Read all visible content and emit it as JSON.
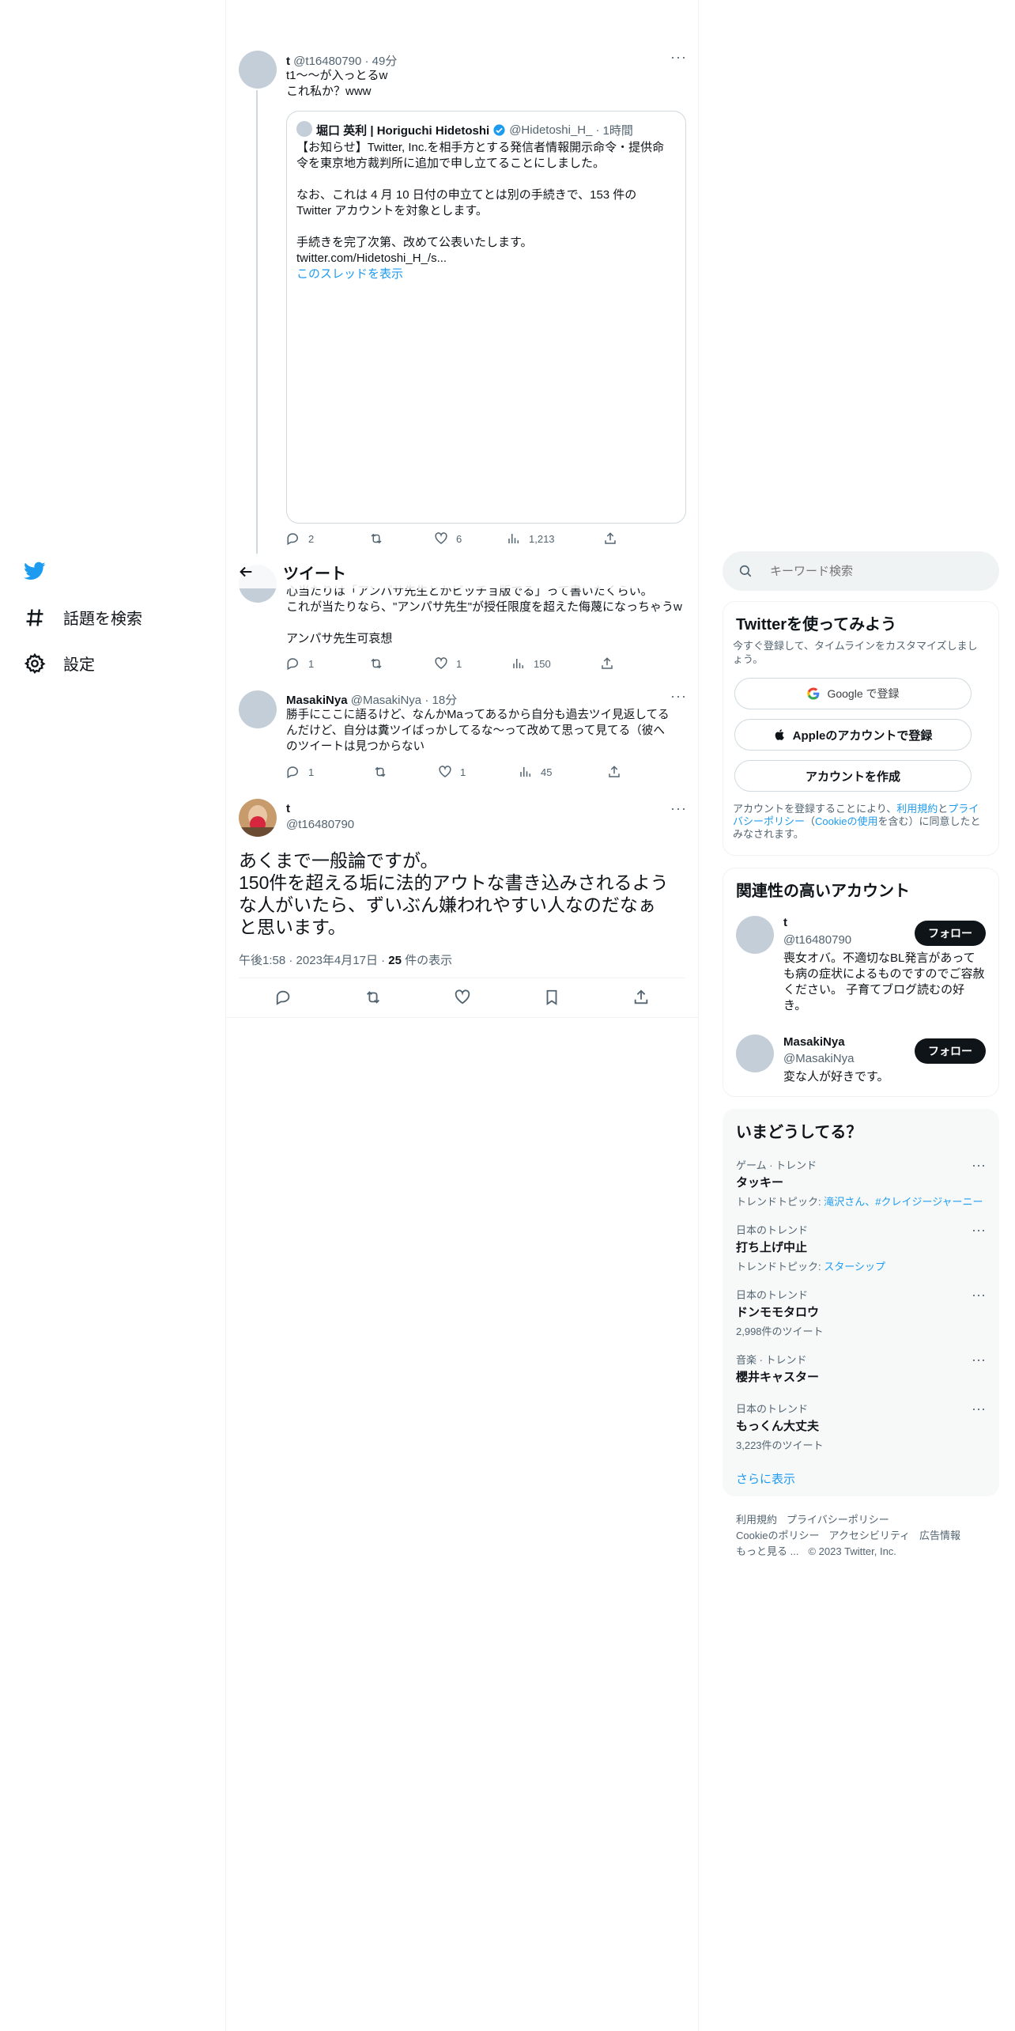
{
  "colors": {
    "accent": "#1d9bf0",
    "text": "#0f1419",
    "muted": "#536471",
    "border": "#eff3f4"
  },
  "nav": {
    "items": [
      {
        "label": "話題を検索",
        "icon": "hashtag-icon"
      },
      {
        "label": "設定",
        "icon": "gear-icon"
      }
    ]
  },
  "header": {
    "title": "ツイート"
  },
  "reply1": {
    "name": "t",
    "handle": "@t16480790",
    "time": "49分",
    "lines": [
      "t1〜〜が入っとるw",
      "これ私か？www"
    ],
    "quote": {
      "name": "堀口 英利 | Horiguchi Hidetoshi",
      "handle": "@Hidetoshi_H_",
      "time": "1時間",
      "lines": [
        "【お知らせ】Twitter, Inc.を相手方とする発信者情報開示命令・提供命",
        "令を東京地方裁判所に追加で申し立てることにしました。",
        "",
        "なお、これは 4 月 10 日付の申立てとは別の手続きで、153 件の",
        "Twitter アカウントを対象とします。",
        "",
        "手続きを完了次第、改めて公表いたします。",
        "twitter.com/Hidetoshi_H_/s..."
      ],
      "thread_link": "このスレッドを表示"
    },
    "stats": {
      "replies": "2",
      "retweets": "",
      "likes": "6",
      "views": "1,213"
    }
  },
  "reply2": {
    "lines": [
      "心当たりは「アンパサ先生とかピッチョ版でる」って書いたくらい。",
      "これが当たりなら、\"アンパサ先生\"が授任限度を超えた侮蔑になっちゃうw",
      "",
      "アンパサ先生可哀想"
    ],
    "stats": {
      "replies": "1",
      "retweets": "",
      "likes": "1",
      "views": "150"
    }
  },
  "reply3": {
    "name": "MasakiNya",
    "handle": "@MasakiNya",
    "time": "18分",
    "lines": [
      "勝手にここに語るけど、なんかMaってあるから自分も過去ツイ見返してる",
      "んだけど、自分は糞ツイばっかしてるな～って改めて思って見てる（彼へ",
      "のツイートは見つからない"
    ],
    "stats": {
      "replies": "1",
      "retweets": "",
      "likes": "1",
      "views": "45"
    }
  },
  "main_tweet": {
    "name": "t",
    "handle": "@t16480790",
    "lines": [
      "あくまで一般論ですが。",
      "150件を超える垢に法的アウトな書き込みされるよう",
      "な人がいたら、ずいぶん嫌われやすい人なのだなぁ",
      "と思います。"
    ],
    "time": "午後1:58",
    "date": "2023年4月17日",
    "views_count": "25",
    "views_label": "件の表示"
  },
  "search": {
    "placeholder": "キーワード検索"
  },
  "signup": {
    "title": "Twitterを使ってみよう",
    "desc_lines": [
      "今すぐ登録して、タイムラインをカスタマイズしまし",
      "ょう。"
    ],
    "google": "Google で登録",
    "apple": "Appleのアカウントで登録",
    "create": "アカウントを作成",
    "terms": {
      "p1": "アカウントを登録することにより、",
      "tos": "利用規約",
      "and": "と",
      "privacy1": "プライ",
      "privacy2": "バシーポリシー",
      "cookie_open": "（",
      "cookie": "Cookieの使用",
      "p2": "を含む）に同意したと",
      "p3": "みなされます。"
    }
  },
  "relevant": {
    "title": "関連性の高いアカウント",
    "follow_label": "フォロー",
    "accounts": [
      {
        "name": "t",
        "handle": "@t16480790",
        "bio_lines": [
          "喪女オバ。不適切なBL発言があって",
          "も病の症状によるものですのでご容赦",
          "ください。 子育てブログ読むの好",
          "き。"
        ]
      },
      {
        "name": "MasakiNya",
        "handle": "@MasakiNya",
        "bio_lines": [
          "変な人が好きです。"
        ]
      }
    ]
  },
  "trends": {
    "title": "いまどうしてる？",
    "items": [
      {
        "category": "ゲーム · トレンド",
        "name": "タッキー",
        "sub_prefix": "トレンドトピック: ",
        "sub_link": "滝沢さん、#クレイジージャーニー"
      },
      {
        "category": "日本のトレンド",
        "name": "打ち上げ中止",
        "sub_prefix": "トレンドトピック: ",
        "sub_link": "スターシップ"
      },
      {
        "category": "日本のトレンド",
        "name": "ドンモモタロウ",
        "sub_prefix": "2,998件のツイート",
        "sub_link": ""
      },
      {
        "category": "音楽 · トレンド",
        "name": "櫻井キャスター",
        "sub_prefix": "",
        "sub_link": ""
      },
      {
        "category": "日本のトレンド",
        "name": "もっくん大丈夫",
        "sub_prefix": "3,223件のツイート",
        "sub_link": ""
      }
    ],
    "show_more": "さらに表示"
  },
  "footer": {
    "row1": [
      "利用規約",
      "プライバシーポリシー"
    ],
    "row2": [
      "Cookieのポリシー",
      "アクセシビリティ",
      "広告情報"
    ],
    "more": "もっと見る ...",
    "copyright": "© 2023 Twitter, Inc."
  }
}
